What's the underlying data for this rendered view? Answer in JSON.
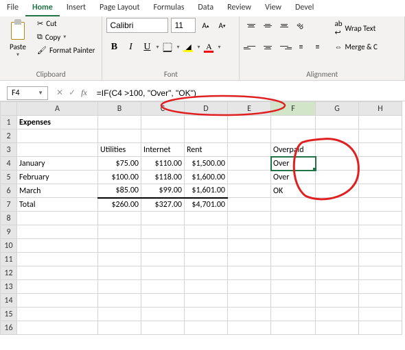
{
  "tabs": [
    "File",
    "Home",
    "Insert",
    "Page Layout",
    "Formulas",
    "Data",
    "Review",
    "View",
    "Devel"
  ],
  "active_tab": "Home",
  "ribbon": {
    "clipboard": {
      "paste": "Paste",
      "cut": "Cut",
      "copy": "Copy",
      "format_painter": "Format Painter",
      "label": "Clipboard"
    },
    "font": {
      "name": "Calibri",
      "size": "11",
      "label": "Font"
    },
    "alignment": {
      "wrap": "Wrap Text",
      "merge": "Merge & C",
      "label": "Alignment"
    }
  },
  "namebox": "F4",
  "formula": "=IF(C4 >100, \"Over\", \"OK\")",
  "columns": [
    "A",
    "B",
    "C",
    "D",
    "E",
    "F",
    "G",
    "H"
  ],
  "sheet": {
    "title": "Expenses",
    "headers": {
      "b": "Utilities",
      "c": "Internet",
      "d": "Rent",
      "f": "Overpaid"
    },
    "rows": [
      {
        "a": "January",
        "b": "$75.00",
        "c": "$110.00",
        "d": "$1,500.00",
        "f": "Over"
      },
      {
        "a": "February",
        "b": "$100.00",
        "c": "$118.00",
        "d": "$1,600.00",
        "f": "Over"
      },
      {
        "a": "March",
        "b": "$85.00",
        "c": "$99.00",
        "d": "$1,601.00",
        "f": "OK"
      }
    ],
    "total": {
      "a": "Total",
      "b": "$260.00",
      "c": "$327.00",
      "d": "$4,701.00"
    }
  },
  "annotations": {
    "color": "#e02020"
  }
}
